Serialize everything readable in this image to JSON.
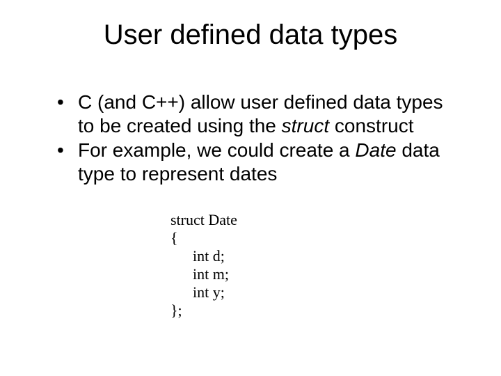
{
  "title": "User defined data types",
  "bullets": {
    "b1_pre": "C (and C++) allow user defined data types to be created using the ",
    "b1_em": "struct",
    "b1_post": " construct",
    "b2_pre": "For example, we could create a ",
    "b2_em": "Date",
    "b2_post": " data type to represent dates"
  },
  "code": {
    "l1": "struct Date",
    "l2": "{",
    "l3": "int d;",
    "l4": "int m;",
    "l5": "int y;",
    "l6": "};"
  }
}
